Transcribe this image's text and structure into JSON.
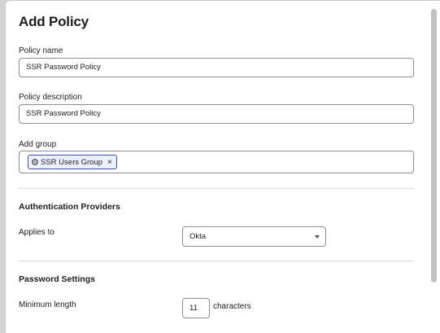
{
  "modal": {
    "title": "Add Policy"
  },
  "fields": {
    "policy_name": {
      "label": "Policy name",
      "value": "SSR Password Policy"
    },
    "policy_description": {
      "label": "Policy description",
      "value": "SSR Password Policy"
    },
    "add_group": {
      "label": "Add group",
      "chips": [
        {
          "label": "SSR Users Group",
          "icon": "group-icon",
          "remove": "×"
        }
      ]
    }
  },
  "auth_providers": {
    "heading": "Authentication Providers",
    "applies_to_label": "Applies to",
    "applies_to_value": "Okta"
  },
  "password_settings": {
    "heading": "Password Settings",
    "min_length_label": "Minimum length",
    "min_length_value": "11",
    "min_length_suffix": "characters"
  }
}
